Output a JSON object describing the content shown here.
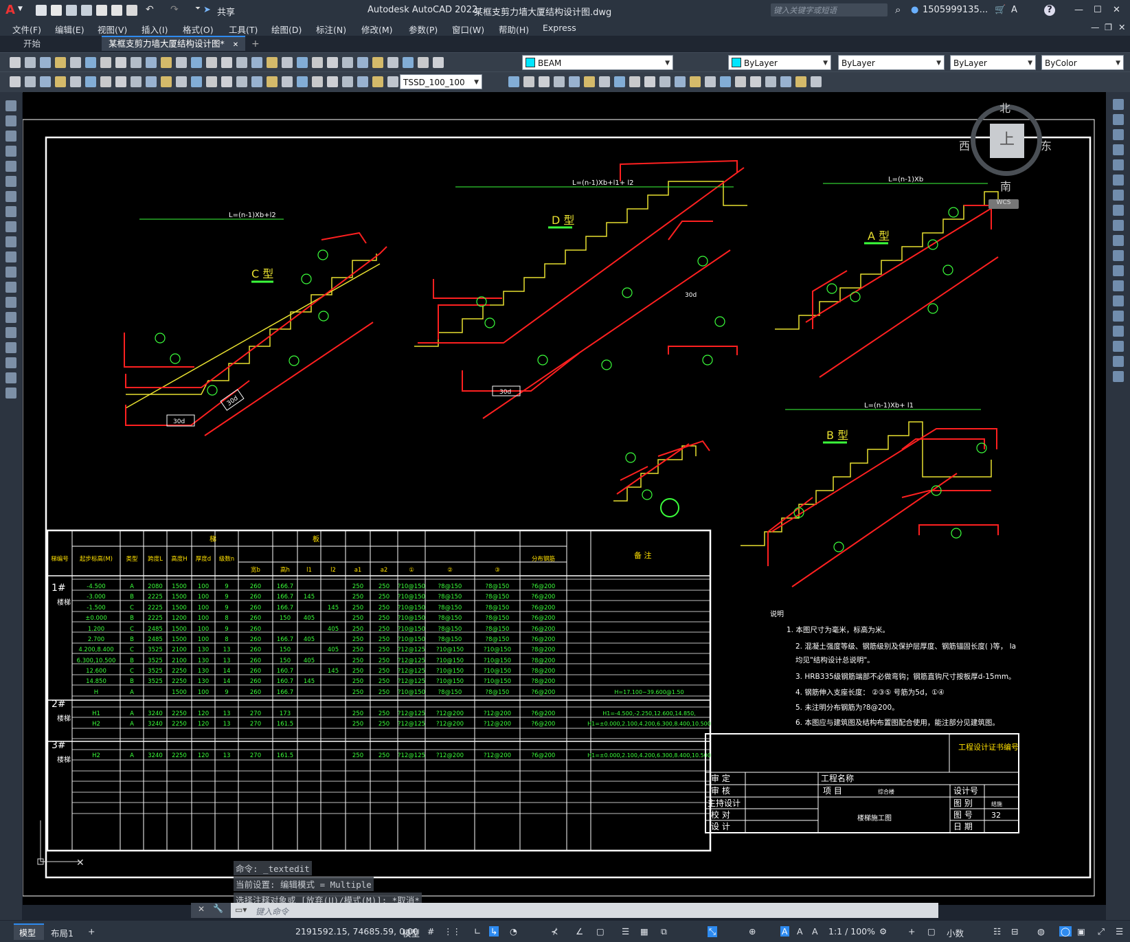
{
  "app": {
    "title": "Autodesk AutoCAD 2022",
    "document": "某框支剪力墙大厦结构设计图.dwg",
    "share": "共享",
    "search_placeholder": "键入关键字或短语",
    "user": "1505999135..."
  },
  "menu": [
    "文件(F)",
    "编辑(E)",
    "视图(V)",
    "插入(I)",
    "格式(O)",
    "工具(T)",
    "绘图(D)",
    "标注(N)",
    "修改(M)",
    "参数(P)",
    "窗口(W)",
    "帮助(H)",
    "Express"
  ],
  "tabs": {
    "start": "开始",
    "active": "某框支剪力墙大厦结构设计图*"
  },
  "toolbar": {
    "layer": "BEAM",
    "color": "ByLayer",
    "linetype": "ByLayer",
    "lineweight": "ByLayer",
    "plotstyle": "ByColor",
    "dimstyle": "TSSD_100_100"
  },
  "viewcube": {
    "north": "北",
    "south": "南",
    "east": "东",
    "west": "西",
    "top": "上",
    "wcs": "WCS"
  },
  "drawing": {
    "type_c": "C 型",
    "type_d": "D 型",
    "type_a": "A 型",
    "type_b": "B 型",
    "len_c": "L=(n-1)Xb+l2",
    "len_d": "L=(n-1)Xb+l1+ l2",
    "len_a": "L=(n-1)Xb",
    "len_b": "L=(n-1)Xb+ l1",
    "table_header_stair": "梯",
    "table_header_board": "板",
    "table_header_note": "备 注",
    "col_headers": [
      "梯编号",
      "起步标高(M)",
      "类型",
      "跨度L",
      "高度H",
      "厚度d",
      "级数n",
      "宽b",
      "高h",
      "l1",
      "l2",
      "a1",
      "a2",
      "①",
      "②",
      "③",
      "分布钢筋"
    ],
    "group1": "1#楼梯",
    "group2": "2#楼梯",
    "group3": "3#楼梯",
    "rows": [
      [
        "-4.500",
        "A",
        "2080",
        "1500",
        "100",
        "9",
        "260",
        "166.7",
        "",
        "",
        "250",
        "250",
        "?10@150",
        "?8@150",
        "?8@150",
        "?6@200",
        ""
      ],
      [
        "-3.000",
        "B",
        "2225",
        "1500",
        "100",
        "9",
        "260",
        "166.7",
        "145",
        "",
        "250",
        "250",
        "?10@150",
        "?8@150",
        "?8@150",
        "?6@200",
        ""
      ],
      [
        "-1.500",
        "C",
        "2225",
        "1500",
        "100",
        "9",
        "260",
        "166.7",
        "",
        "145",
        "250",
        "250",
        "?10@150",
        "?8@150",
        "?8@150",
        "?6@200",
        ""
      ],
      [
        "±0.000",
        "B",
        "2225",
        "1200",
        "100",
        "8",
        "260",
        "150",
        "405",
        "",
        "250",
        "250",
        "?10@150",
        "?8@150",
        "?8@150",
        "?6@200",
        ""
      ],
      [
        "1.200",
        "C",
        "2485",
        "1500",
        "100",
        "9",
        "260",
        "",
        "",
        "405",
        "250",
        "250",
        "?10@150",
        "?8@150",
        "?8@150",
        "?6@200",
        ""
      ],
      [
        "2.700",
        "B",
        "2485",
        "1500",
        "100",
        "8",
        "260",
        "166.7",
        "405",
        "",
        "250",
        "250",
        "?10@150",
        "?8@150",
        "?8@150",
        "?6@200",
        ""
      ],
      [
        "4.200,8.400",
        "C",
        "3525",
        "2100",
        "130",
        "13",
        "260",
        "150",
        "",
        "405",
        "250",
        "250",
        "?12@125",
        "?10@150",
        "?10@150",
        "?8@200",
        ""
      ],
      [
        "6.300,10.500",
        "B",
        "3525",
        "2100",
        "130",
        "13",
        "260",
        "150",
        "405",
        "",
        "250",
        "250",
        "?12@125",
        "?10@150",
        "?10@150",
        "?8@200",
        ""
      ],
      [
        "12.600",
        "C",
        "3525",
        "2250",
        "130",
        "14",
        "260",
        "160.7",
        "",
        "145",
        "250",
        "250",
        "?12@125",
        "?10@150",
        "?10@150",
        "?8@200",
        ""
      ],
      [
        "14.850",
        "B",
        "3525",
        "2250",
        "130",
        "14",
        "260",
        "160.7",
        "145",
        "",
        "250",
        "250",
        "?12@125",
        "?10@150",
        "?10@150",
        "?8@200",
        ""
      ],
      [
        "H",
        "A",
        "",
        "1500",
        "100",
        "9",
        "260",
        "166.7",
        "",
        "",
        "250",
        "250",
        "?10@150",
        "?8@150",
        "?8@150",
        "?6@200",
        "H=17.100~39.600@1.50"
      ],
      [
        "H1",
        "A",
        "3240",
        "2250",
        "120",
        "13",
        "270",
        "173",
        "",
        "",
        "250",
        "250",
        "?12@125",
        "?12@200",
        "?12@200",
        "?6@200",
        "H1=-4.500,-2.250,12.600,14.850,"
      ],
      [
        "H2",
        "A",
        "3240",
        "2250",
        "120",
        "13",
        "270",
        "161.5",
        "",
        "",
        "250",
        "250",
        "?12@125",
        "?12@200",
        "?12@200",
        "?6@200",
        "H1=±0.000,2.100,4.200,6.300,8.400,10.500"
      ],
      [
        "H2",
        "A",
        "3240",
        "2250",
        "120",
        "13",
        "270",
        "161.5",
        "",
        "",
        "250",
        "250",
        "?12@125",
        "?12@200",
        "?12@200",
        "?6@200",
        "H1=±0.000,2.100,4.200,6.300,8.400,10.500"
      ]
    ],
    "notes_title": "说明",
    "notes": [
      "1. 本图尺寸为毫米，标高为米。",
      "2. 混凝土强度等级、钢筋级别及保护层厚度、钢筋锚固长度(  )等，     la",
      "   均见\"结构设计总说明\"。",
      "3. HRB335级钢筋端部不必做弯钩；钢筋直钩尺寸按板厚d-15mm。",
      "4. 钢筋伸入支座长度：  ②③⑤  号筋为5d，①④",
      "5. 未注明分布钢筋为?8@200。",
      "6. 本图应与建筑图及结构布置图配合使用，能注部分见建筑图。"
    ],
    "title_block": {
      "cert": "工程设计证书编号",
      "approve": "审 定",
      "check": "审 核",
      "chief": "主持设计",
      "proof": "校 对",
      "design": "设 计",
      "project_name": "工程名称",
      "item": "项 目",
      "item_value": "综合楼",
      "drawing_name": "楼梯施工图",
      "design_no": "设计号",
      "category": "图 别",
      "category_value": "结施",
      "sheet_no": "图 号",
      "sheet_value": "32",
      "date": "日 期"
    }
  },
  "command": {
    "history": [
      "命令: _textedit",
      "当前设置: 编辑模式 = Multiple",
      "选择注释对象或 [放弃(U)/模式(M)]: *取消*"
    ],
    "placeholder": "键入命令"
  },
  "status": {
    "model_tab": "模型",
    "layout_tab": "布局1",
    "coords": "2191592.15, 74685.59, 0.00",
    "space": "模型",
    "scale": "1:1 / 100%",
    "units": "小数"
  }
}
